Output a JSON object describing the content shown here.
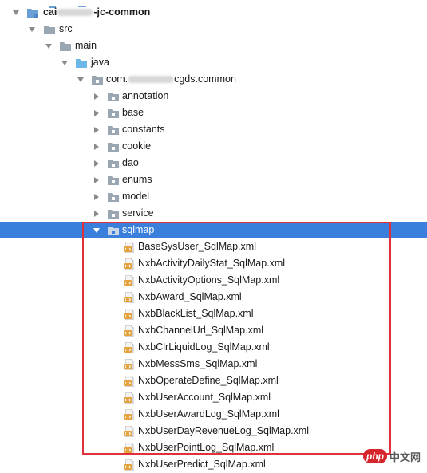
{
  "project": {
    "name_prefix": "cai",
    "name_suffix": "-jc-common"
  },
  "folders": {
    "src": "src",
    "main": "main",
    "java": "java",
    "package_prefix": "com.",
    "package_suffix": "cgds.common"
  },
  "packages": [
    "annotation",
    "base",
    "constants",
    "cookie",
    "dao",
    "enums",
    "model",
    "service"
  ],
  "selected_package": "sqlmap",
  "files": [
    "BaseSysUser_SqlMap.xml",
    "NxbActivityDailyStat_SqlMap.xml",
    "NxbActivityOptions_SqlMap.xml",
    "NxbAward_SqlMap.xml",
    "NxbBlackList_SqlMap.xml",
    "NxbChannelUrl_SqlMap.xml",
    "NxbClrLiquidLog_SqlMap.xml",
    "NxbMessSms_SqlMap.xml",
    "NxbOperateDefine_SqlMap.xml",
    "NxbUserAccount_SqlMap.xml",
    "NxbUserAwardLog_SqlMap.xml",
    "NxbUserDayRevenueLog_SqlMap.xml",
    "NxbUserPointLog_SqlMap.xml",
    "NxbUserPredict_SqlMap.xml"
  ],
  "watermark": {
    "badge": "php",
    "text": "中文网"
  },
  "colors": {
    "selection": "#3b7fdc",
    "highlight_border": "#e0303a",
    "folder": "#9aa7b3",
    "module_folder": "#6a9fd6",
    "source_folder": "#6ab7e8",
    "xml_icon": "#e3a23b"
  },
  "icons": {
    "expanded": "triangle-down-icon",
    "collapsed": "triangle-right-icon",
    "folder": "folder-icon",
    "package": "package-folder-icon",
    "xml": "xml-file-icon"
  }
}
